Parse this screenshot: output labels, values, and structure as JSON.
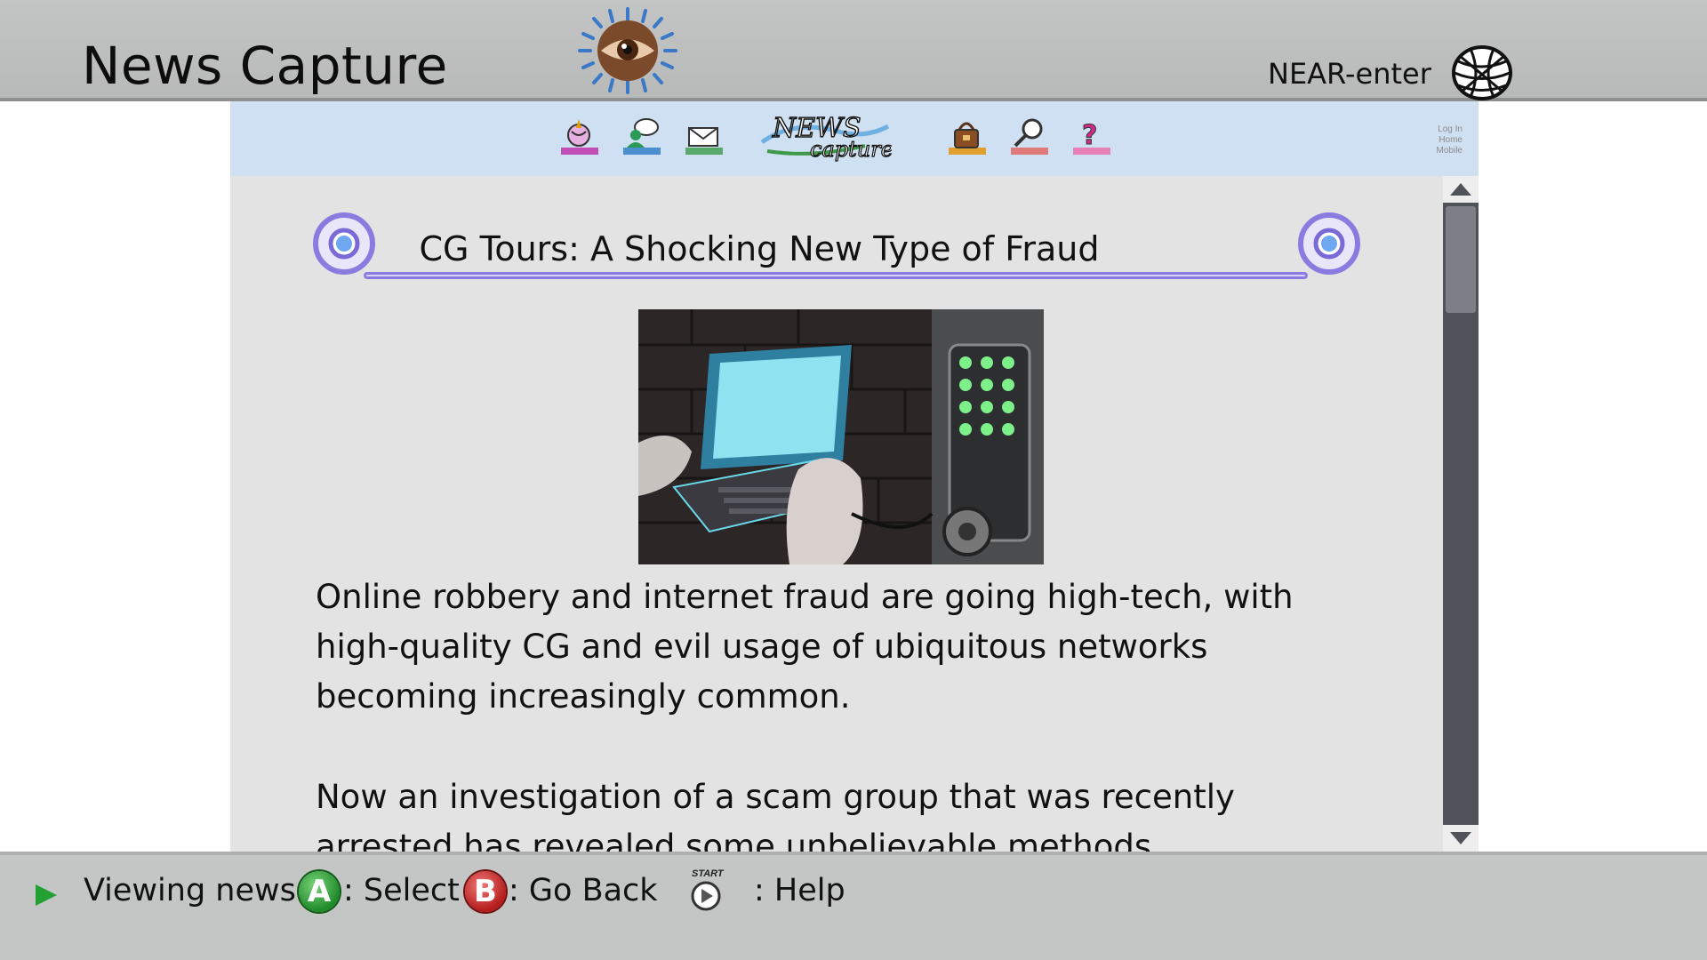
{
  "header": {
    "title": "News Capture",
    "service_name": "NEAR-enter"
  },
  "site_nav": {
    "icons": [
      "globe-pin-icon",
      "chat-user-icon",
      "mail-icon",
      "shop-bag-icon",
      "search-icon",
      "help-icon"
    ],
    "logo_text_top": "NEWS",
    "logo_text_bottom": "capture",
    "account_links": [
      "Log In",
      "Home",
      "Mobile"
    ]
  },
  "article": {
    "headline": "CG Tours: A Shocking New Type of Fraud",
    "image_description_icon": "laptop-keypad-hacking-image",
    "paragraphs": [
      "Online robbery and internet fraud are going high-tech, with high-quality CG and evil usage of ubiquitous networks becoming increasingly common.",
      "Now an investigation of a scam group that was recently arrested has revealed some unbelievable methods"
    ]
  },
  "status_bar": {
    "status": "Viewing news.",
    "a_glyph": "A",
    "a_action": ": Select",
    "b_glyph": "B",
    "b_action": ": Go Back",
    "start_label": "START",
    "start_action": ": Help"
  },
  "colors": {
    "header_bg": "#c3c4c4",
    "nav_bg": "#cfe0f2",
    "article_bg": "#e3e3e3",
    "scrollbar": "#4f5259",
    "headline_accent": "#8a7be0",
    "a_button": "#1f8a2a",
    "b_button": "#b51c1c"
  }
}
